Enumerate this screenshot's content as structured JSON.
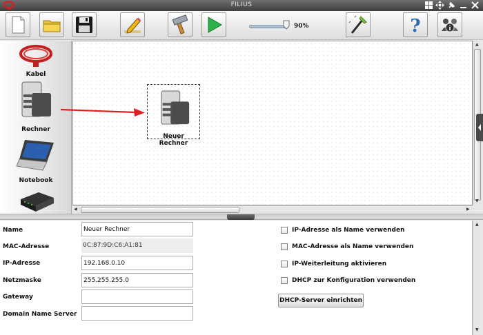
{
  "window": {
    "title": "FILIUS"
  },
  "toolbar": {
    "zoom_label": "90%",
    "zoom_value": 0.9,
    "buttons": [
      "new-file",
      "open-folder",
      "save",
      "edit-mode",
      "hammer",
      "play",
      "wizard",
      "help",
      "info"
    ]
  },
  "palette": {
    "items": [
      {
        "label": "Kabel"
      },
      {
        "label": "Rechner"
      },
      {
        "label": "Notebook"
      },
      {
        "label": ""
      }
    ]
  },
  "canvas": {
    "node_label": "Neuer Rechner"
  },
  "properties": {
    "fields": [
      {
        "label": "Name",
        "value": "Neuer Rechner"
      },
      {
        "label": "MAC-Adresse",
        "value": "0C:87:9D:C6:A1:81"
      },
      {
        "label": "IP-Adresse",
        "value": "192.168.0.10"
      },
      {
        "label": "Netzmaske",
        "value": "255.255.255.0"
      },
      {
        "label": "Gateway",
        "value": ""
      },
      {
        "label": "Domain Name Server",
        "value": ""
      }
    ],
    "checkboxes": [
      {
        "label": "IP-Adresse als Name verwenden"
      },
      {
        "label": "MAC-Adresse als Name verwenden"
      },
      {
        "label": "IP-Weiterleitung aktivieren"
      },
      {
        "label": "DHCP zur Konfiguration verwenden"
      }
    ],
    "dhcp_button": "DHCP-Server einrichten"
  },
  "colors": {
    "arrow": "#e02020",
    "cable": "#d42020",
    "play": "#2db14a"
  }
}
